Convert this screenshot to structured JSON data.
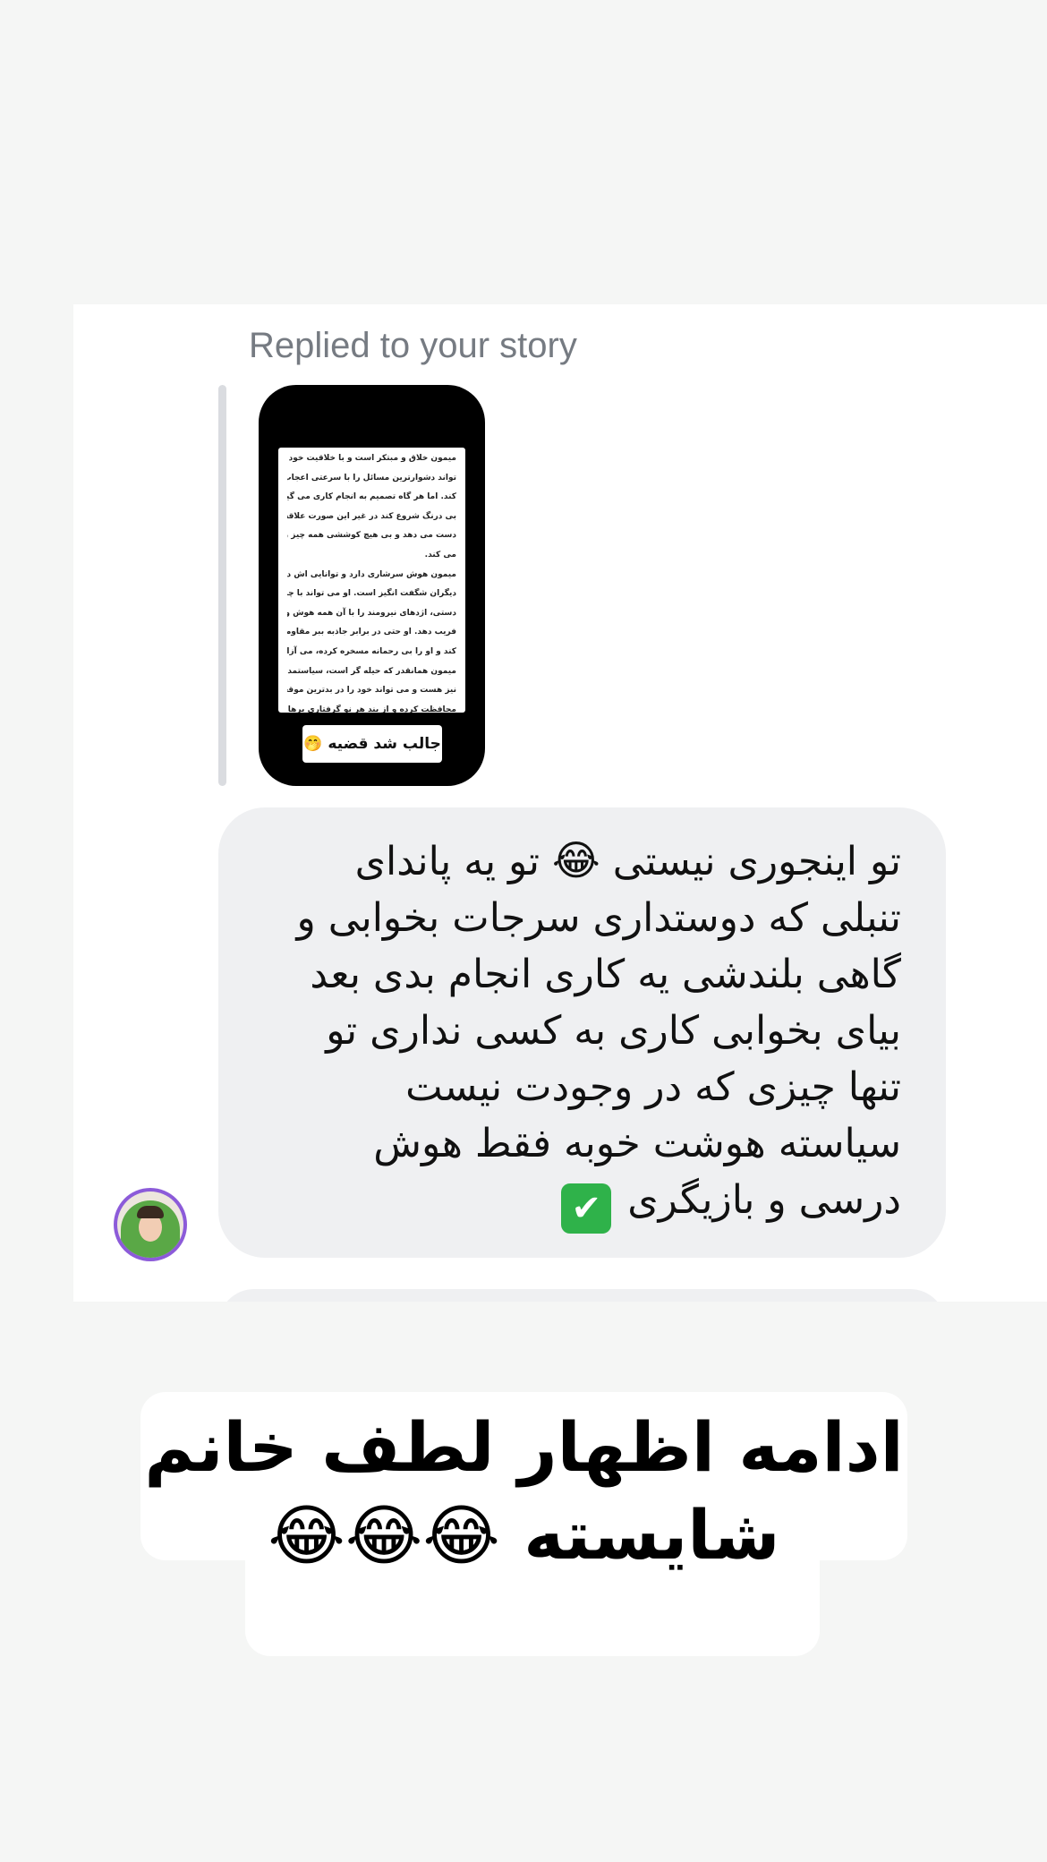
{
  "reply_header": "Replied to your story",
  "story": {
    "lines": [
      "میمون خلاق و مبتکر است و با خلاقیت خود می",
      "تواند دشوارترین مسائل را با سرعتی اعجاب انگیز حل",
      "کند. اما هر گاه تصمیم به انجام کاری می گیرد، باید",
      "بی درنگ شروع کند در غیر این صورت علاقه خود را از",
      "دست می دهد و بی هیچ کوششی همه چیز را رها",
      "می کند.",
      "میمون هوش سرشاری دارد و توانایی اش در فریفتن",
      "دیگران شگفت انگیز است. او می تواند با چیره",
      "دستی، اژدهای نیرومند را با آن همه هوش و درایت،",
      "فریب دهد. او حتی در برابر جاذبه ببر مقاومت می",
      "کند و او را بی رحمانه مسخره کرده، می آزارد.",
      "میمون همانقدر که حیله گر است، سیاستمدار و زیرک",
      "نیز هست و می تواند خود را در بدترین موقعیت ها",
      "محافظت کرده و از بند هر نو گرفتاری برهاند. او خود"
    ],
    "sticker_text": "جالب شد قضیه",
    "sticker_emoji": "🤭"
  },
  "message": {
    "lines": [
      [
        "تو اینجوری نیستی ",
        "😂",
        " تو یه پاندای"
      ],
      [
        "تنبلی که دوستداری سرجات بخوابی و"
      ],
      [
        "گاهی بلندشی یه کاری انجام بدی بعد"
      ],
      [
        "بیای بخوابی کاری به کسی نداری تو"
      ],
      [
        "تنها چیزی که در وجودت نیست"
      ],
      [
        "سیاسته  هوشت خوبه فقط هوش"
      ]
    ],
    "last_line_text": "درسی و بازیگری ",
    "last_line_emoji": "✔"
  },
  "avatar": {
    "ring_color": "#8c5bd9",
    "scarf_color": "#5aa846"
  },
  "caption": {
    "line1": "ادامه اظهار لطف خانم",
    "line2_text": "شایسته ",
    "line2_emoji": "😂😂😂"
  }
}
